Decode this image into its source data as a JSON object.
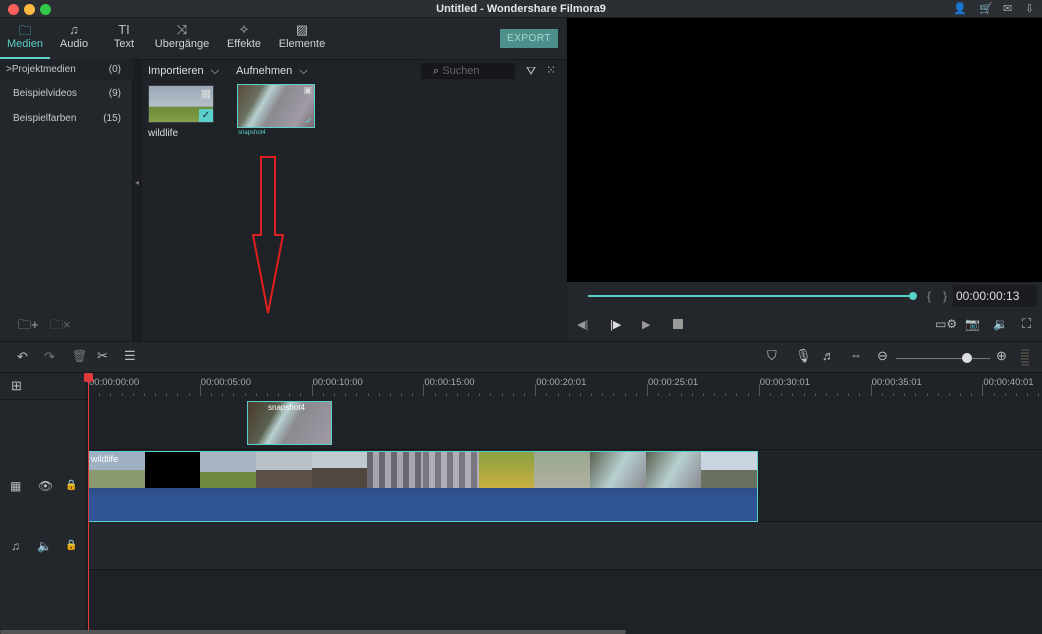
{
  "window": {
    "title": "Untitled - Wondershare Filmora9"
  },
  "tabs": [
    {
      "label": "Medien",
      "icon": "folder-icon"
    },
    {
      "label": "Audio",
      "icon": "music-note-icon"
    },
    {
      "label": "Text",
      "icon": "text-icon"
    },
    {
      "label": "Ubergänge",
      "icon": "transition-icon"
    },
    {
      "label": "Effekte",
      "icon": "effects-icon"
    },
    {
      "label": "Elemente",
      "icon": "image-icon"
    }
  ],
  "export_label": "EXPORT",
  "sidebar": {
    "items": [
      {
        "label": "Projektmedien",
        "count": "(0)",
        "chevron": ">"
      },
      {
        "label": "Beispielvideos",
        "count": "(9)"
      },
      {
        "label": "Beispielfarben",
        "count": "(15)"
      }
    ]
  },
  "media": {
    "import_label": "Importieren",
    "record_label": "Aufnehmen",
    "search_placeholder": "Suchen",
    "items": [
      {
        "name": "wildlife"
      },
      {
        "name": "snapshot4"
      }
    ]
  },
  "preview": {
    "timecode": "00:00:00:13",
    "progress": 0.99,
    "bracket_left": "{",
    "bracket_right": "}"
  },
  "timeline": {
    "ruler": [
      "00:00:00:00",
      "00:00:05:00",
      "00:00:10:00",
      "00:00:15:00",
      "00:00:20:01",
      "00:00:25:01",
      "00:00:30:01",
      "00:00:35:01",
      "00:00:40:01"
    ],
    "zoom_level": 0.75,
    "overlay_clip": "snapshot4",
    "main_clip": "wildlife"
  },
  "colors": {
    "accent": "#5ad0c8",
    "playhead": "#e03a3a",
    "audio_track": "#2f5597"
  }
}
